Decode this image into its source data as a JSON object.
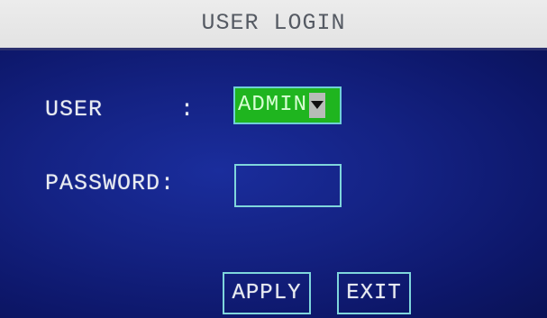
{
  "window": {
    "title": "USER LOGIN"
  },
  "form": {
    "user_label": "USER",
    "user_colon": ":",
    "user_value": "ADMIN",
    "password_label": "PASSWORD:",
    "password_value": ""
  },
  "buttons": {
    "apply_label": "APPLY",
    "exit_label": "EXIT"
  },
  "icons": {
    "dropdown": "chevron-down-icon"
  },
  "colors": {
    "title_bar": "#e6e6e6",
    "panel": "#142283",
    "selected_field": "#1fb51f",
    "field_border": "#7fd6dc",
    "text": "#e9ecf2"
  }
}
